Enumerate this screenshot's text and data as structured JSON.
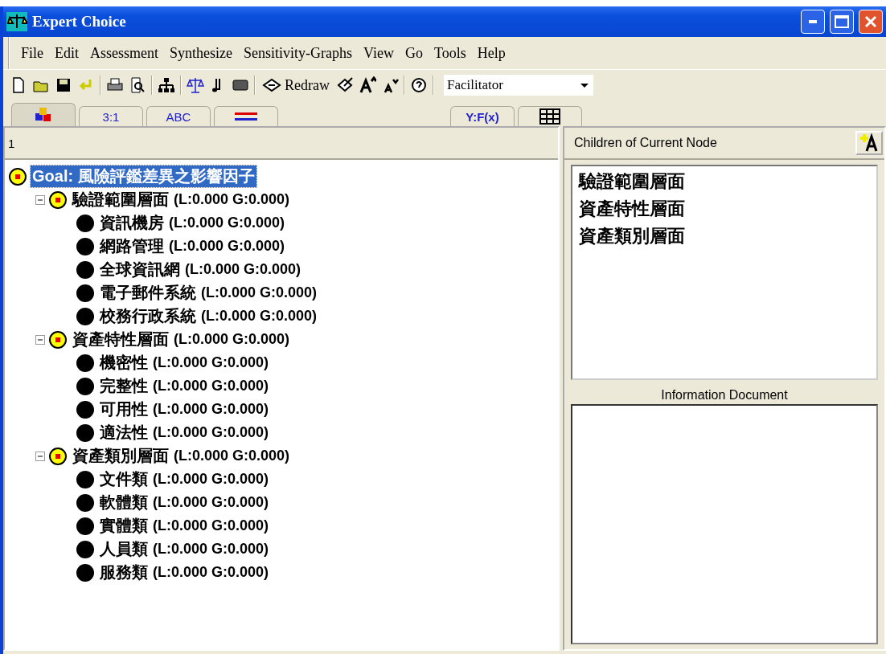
{
  "window": {
    "title": "Expert Choice"
  },
  "menu": [
    "File",
    "Edit",
    "Assessment",
    "Synthesize",
    "Sensitivity-Graphs",
    "View",
    "Go",
    "Tools",
    "Help"
  ],
  "toolbar": {
    "redraw_label": "Redraw",
    "mode_combo": {
      "value": "Facilitator"
    }
  },
  "tabs": [
    {
      "kind": "icon",
      "selected": true
    },
    {
      "kind": "text",
      "label": "3:1",
      "selected": false
    },
    {
      "kind": "text",
      "label": "ABC",
      "selected": false
    },
    {
      "kind": "lines",
      "selected": false
    },
    {
      "kind": "text",
      "label": "Y:F(x)",
      "selected": false
    },
    {
      "kind": "grid",
      "selected": false
    }
  ],
  "tree_pane": {
    "header": "1",
    "tree": [
      {
        "kind": "goal",
        "label": "Goal: 風險評鑑差異之影響因子",
        "selected": true,
        "children": [
          {
            "kind": "cluster",
            "label": "驗證範圍層面",
            "priority": "(L:0.000 G:0.000)",
            "selected": false,
            "expanded": true,
            "children": [
              {
                "kind": "leaf",
                "label": "資訊機房",
                "priority": "(L:0.000 G:0.000)",
                "selected": false
              },
              {
                "kind": "leaf",
                "label": "網路管理",
                "priority": "(L:0.000 G:0.000)",
                "selected": false
              },
              {
                "kind": "leaf",
                "label": "全球資訊網",
                "priority": "(L:0.000 G:0.000)",
                "selected": false
              },
              {
                "kind": "leaf",
                "label": "電子郵件系統",
                "priority": "(L:0.000 G:0.000)",
                "selected": false
              },
              {
                "kind": "leaf",
                "label": "校務行政系統",
                "priority": "(L:0.000 G:0.000)",
                "selected": false
              }
            ]
          },
          {
            "kind": "cluster",
            "label": "資產特性層面",
            "priority": "(L:0.000 G:0.000)",
            "selected": false,
            "expanded": true,
            "children": [
              {
                "kind": "leaf",
                "label": "機密性",
                "priority": "(L:0.000 G:0.000)",
                "selected": false
              },
              {
                "kind": "leaf",
                "label": "完整性",
                "priority": "(L:0.000 G:0.000)",
                "selected": false
              },
              {
                "kind": "leaf",
                "label": "可用性",
                "priority": "(L:0.000 G:0.000)",
                "selected": false
              },
              {
                "kind": "leaf",
                "label": "適法性",
                "priority": "(L:0.000 G:0.000)",
                "selected": false
              }
            ]
          },
          {
            "kind": "cluster",
            "label": "資產類別層面",
            "priority": "(L:0.000 G:0.000)",
            "selected": false,
            "expanded": true,
            "children": [
              {
                "kind": "leaf",
                "label": "文件類",
                "priority": "(L:0.000 G:0.000)",
                "selected": false
              },
              {
                "kind": "leaf",
                "label": "軟體類",
                "priority": "(L:0.000 G:0.000)",
                "selected": false
              },
              {
                "kind": "leaf",
                "label": "實體類",
                "priority": "(L:0.000 G:0.000)",
                "selected": false
              },
              {
                "kind": "leaf",
                "label": "人員類",
                "priority": "(L:0.000 G:0.000)",
                "selected": false
              },
              {
                "kind": "leaf",
                "label": "服務類",
                "priority": "(L:0.000 G:0.000)",
                "selected": false
              }
            ]
          }
        ]
      }
    ]
  },
  "right_pane": {
    "header": "Children of Current Node",
    "children": [
      "驗證範圍層面",
      "資產特性層面",
      "資產類別層面"
    ],
    "info_label": "Information Document"
  }
}
